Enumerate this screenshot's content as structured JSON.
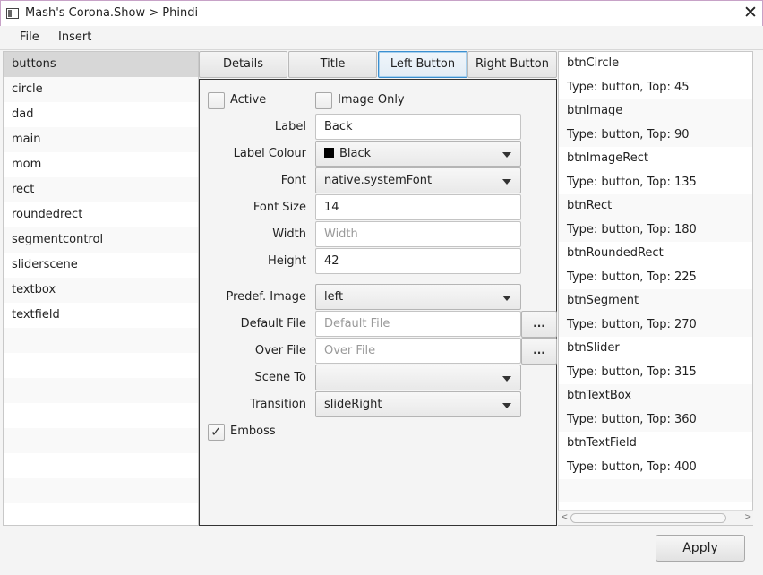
{
  "window": {
    "title": "Mash's Corona.Show > Phindi",
    "close_glyph": "✕"
  },
  "menu": {
    "items": [
      "File",
      "Insert"
    ]
  },
  "scenes": {
    "items": [
      "buttons",
      "circle",
      "dad",
      "main",
      "mom",
      "rect",
      "roundedrect",
      "segmentcontrol",
      "sliderscene",
      "textbox",
      "textfield"
    ],
    "selected": "buttons"
  },
  "tabs": {
    "items": [
      "Details",
      "Title",
      "Left Button",
      "Right Button"
    ],
    "active": "Left Button"
  },
  "form": {
    "active_label": "Active",
    "active_checked": false,
    "image_only_label": "Image Only",
    "image_only_checked": false,
    "label_label": "Label",
    "label_value": "Back",
    "label_colour_label": "Label Colour",
    "label_colour_value": "Black",
    "label_colour_swatch": "#000000",
    "font_label": "Font",
    "font_value": "native.systemFont",
    "font_size_label": "Font Size",
    "font_size_value": "14",
    "width_label": "Width",
    "width_placeholder": "Width",
    "height_label": "Height",
    "height_value": "42",
    "predef_image_label": "Predef. Image",
    "predef_image_value": "left",
    "default_file_label": "Default File",
    "default_file_placeholder": "Default File",
    "over_file_label": "Over File",
    "over_file_placeholder": "Over File",
    "browse_label": "...",
    "scene_to_label": "Scene To",
    "scene_to_value": "",
    "transition_label": "Transition",
    "transition_value": "slideRight",
    "emboss_label": "Emboss",
    "emboss_checked": true,
    "check_glyph": "✓"
  },
  "objects": {
    "items": [
      {
        "name": "btnCircle",
        "info": "Type: button, Top: 45"
      },
      {
        "name": "btnImage",
        "info": "Type: button, Top: 90"
      },
      {
        "name": "btnImageRect",
        "info": "Type: button, Top: 135"
      },
      {
        "name": "btnRect",
        "info": "Type: button, Top: 180"
      },
      {
        "name": "btnRoundedRect",
        "info": "Type: button, Top: 225"
      },
      {
        "name": "btnSegment",
        "info": "Type: button, Top: 270"
      },
      {
        "name": "btnSlider",
        "info": "Type: button, Top: 315"
      },
      {
        "name": "btnTextBox",
        "info": "Type: button, Top: 360"
      },
      {
        "name": "btnTextField",
        "info": "Type: button, Top: 400"
      }
    ],
    "scroll_left_glyph": "<",
    "scroll_right_glyph": ">"
  },
  "apply_label": "Apply"
}
